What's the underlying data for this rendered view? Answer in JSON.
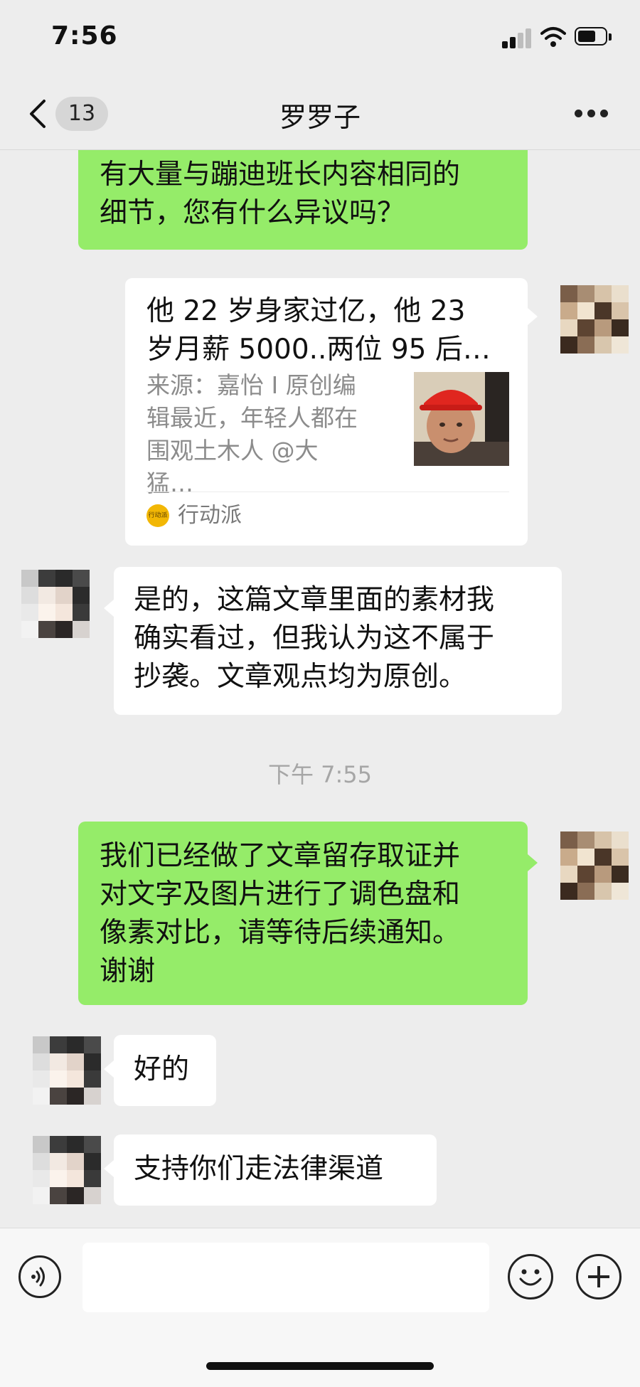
{
  "status_bar": {
    "time": "7:56"
  },
  "nav": {
    "unread_count": "13",
    "title": "罗罗子"
  },
  "messages": [
    {
      "from": "me",
      "lines": [
        "有大量与蹦迪班长内容相同的",
        "细节，您有什么异议吗？"
      ]
    },
    {
      "from": "me",
      "type": "article",
      "title_lines": [
        "他 22 岁身家过亿，他 23",
        "岁月薪 5000..两位 95 后…"
      ],
      "desc_lines": [
        "来源：嘉怡 I 原创编",
        "辑最近，年轻人都在",
        "围观土木人 @大猛…"
      ],
      "source_icon_text": "行动派",
      "source": "行动派"
    },
    {
      "from": "them",
      "lines": [
        "是的，这篇文章里面的素材我",
        "确实看过，但我认为这不属于",
        "抄袭。文章观点均为原创。"
      ]
    },
    {
      "type": "time",
      "text": "下午 7:55"
    },
    {
      "from": "me",
      "lines": [
        "我们已经做了文章留存取证并",
        "对文字及图片进行了调色盘和",
        "像素对比，请等待后续通知。",
        "谢谢"
      ]
    },
    {
      "from": "them",
      "lines": [
        "好的"
      ]
    },
    {
      "from": "them",
      "lines": [
        "支持你们走法律渠道"
      ]
    }
  ],
  "input": {
    "placeholder": ""
  },
  "icons": {
    "back": "chevron-left-icon",
    "more": "more-dots-icon",
    "voice": "voice-icon",
    "emoji": "emoji-icon",
    "plus": "plus-icon"
  },
  "colors": {
    "my_bubble": "#95ec69",
    "their_bubble": "#ffffff",
    "background": "#ededed"
  }
}
